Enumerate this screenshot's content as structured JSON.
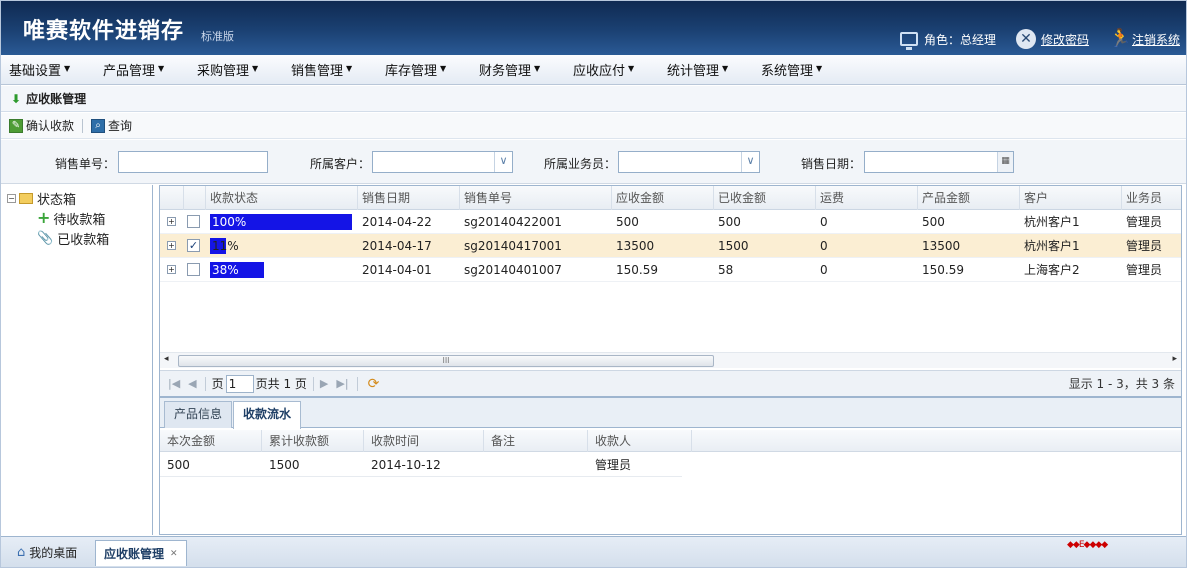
{
  "header": {
    "logo": "唯赛软件进销存",
    "edition": "标准版",
    "role_label": "角色：总经理",
    "change_password": "修改密码",
    "logout": "注销系统"
  },
  "menu": [
    {
      "label": "基础设置"
    },
    {
      "label": "产品管理"
    },
    {
      "label": "采购管理"
    },
    {
      "label": "销售管理"
    },
    {
      "label": "库存管理"
    },
    {
      "label": "财务管理"
    },
    {
      "label": "应收应付"
    },
    {
      "label": "统计管理"
    },
    {
      "label": "系统管理"
    }
  ],
  "panel": {
    "title": "应收账管理"
  },
  "toolbar": {
    "confirm_label": "确认收款",
    "query_label": "查询"
  },
  "search": {
    "order_no_label": "销售单号：",
    "order_no_value": "",
    "customer_label": "所属客户：",
    "customer_value": "",
    "salesman_label": "所属业务员：",
    "salesman_value": "",
    "date_label": "销售日期：",
    "date_value": ""
  },
  "tree": {
    "root": "状态箱",
    "children": [
      "待收款箱",
      "已收款箱"
    ]
  },
  "grid": {
    "columns": [
      "收款状态",
      "销售日期",
      "销售单号",
      "应收金额",
      "已收金额",
      "运费",
      "产品金额",
      "客户",
      "业务员"
    ],
    "rows": [
      {
        "status": "100%",
        "progress": 1.0,
        "checked": false,
        "selected": false,
        "date": "2014-04-22",
        "order_no": "sg20140422001",
        "receivable": "500",
        "received": "500",
        "freight": "0",
        "product_amount": "500",
        "customer": "杭州客户1",
        "salesman": "管理员"
      },
      {
        "status": "11%",
        "progress": 0.11,
        "checked": true,
        "selected": true,
        "date": "2014-04-17",
        "order_no": "sg20140417001",
        "receivable": "13500",
        "received": "1500",
        "freight": "0",
        "product_amount": "13500",
        "customer": "杭州客户1",
        "salesman": "管理员"
      },
      {
        "status": "38%",
        "progress": 0.38,
        "checked": false,
        "selected": false,
        "date": "2014-04-01",
        "order_no": "sg20140401007",
        "receivable": "150.59",
        "received": "58",
        "freight": "0",
        "product_amount": "150.59",
        "customer": "上海客户2",
        "salesman": "管理员"
      }
    ],
    "scroll_marker": "III"
  },
  "pager": {
    "page_label": "页",
    "page_value": "1",
    "total_label": "页共 1 页",
    "info": "显示 1 - 3，共 3 条"
  },
  "detail": {
    "tabs": [
      "产品信息",
      "收款流水"
    ],
    "active_tab": 1,
    "columns": [
      "本次金额",
      "累计收款额",
      "收款时间",
      "备注",
      "收款人"
    ],
    "rows": [
      {
        "amount": "500",
        "cumulative": "1500",
        "time": "2014-10-12",
        "note": "",
        "payee": "管理员"
      }
    ]
  },
  "bottom_tabs": {
    "desktop": "我的桌面",
    "current": "应收账管理"
  },
  "icons": {
    "monitor": "monitor-icon",
    "tools": "tools-icon",
    "logout": "running-man-icon",
    "refresh": "refresh-icon",
    "home": "home-icon"
  },
  "colors": {
    "header": "#1b4173",
    "progress": "#1414e6",
    "selected_row": "#fbeed3"
  }
}
